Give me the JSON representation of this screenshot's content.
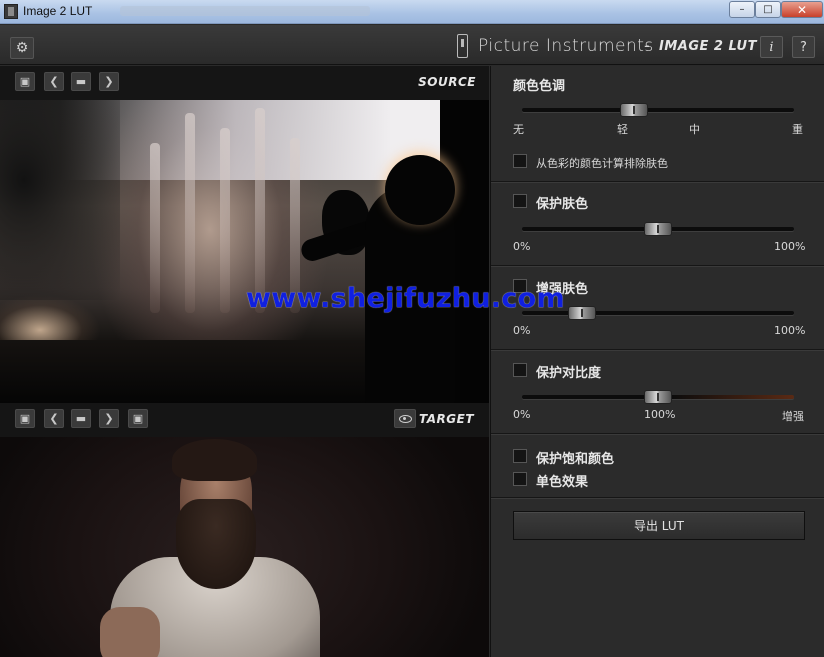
{
  "window": {
    "title": "Image 2 LUT",
    "min_glyph": "–",
    "max_glyph": "□",
    "close_glyph": "✕"
  },
  "header": {
    "settings_glyph": "⚙",
    "brand": "Picture Instruments",
    "separator": "-",
    "product": "IMAGE 2 LUT",
    "info_label": "i",
    "help_label": "?"
  },
  "source": {
    "label": "SOURCE",
    "save_glyph": "▣",
    "prev_glyph": "❮",
    "folder_glyph": "▬",
    "next_glyph": "❯"
  },
  "target": {
    "label": "TARGET",
    "save_glyph": "▣",
    "prev_glyph": "❮",
    "folder_glyph": "▬",
    "next_glyph": "❯",
    "save2_glyph": "▣"
  },
  "watermark": "www.shejifuzhu.com",
  "panel": {
    "tone": {
      "title": "颜色色调",
      "ticks": [
        "无",
        "轻",
        "中",
        "重"
      ],
      "slider_value": 0.41,
      "exclude_label": "从色彩的颜色计算排除肤色",
      "exclude_checked": false
    },
    "protect_skin": {
      "label": "保护肤色",
      "checked": false,
      "min_label": "0%",
      "max_label": "100%",
      "slider_value": 0.5
    },
    "enhance_skin": {
      "label": "增强肤色",
      "checked": false,
      "min_label": "0%",
      "max_label": "100%",
      "slider_value": 0.22
    },
    "protect_contrast": {
      "label": "保护对比度",
      "checked": false,
      "min_label": "0%",
      "mid_label": "100%",
      "max_label": "增强",
      "slider_value": 0.5
    },
    "protect_saturation": {
      "label": "保护饱和颜色",
      "checked": false
    },
    "mono": {
      "label": "单色效果",
      "checked": false
    },
    "export_label": "导出 LUT"
  }
}
